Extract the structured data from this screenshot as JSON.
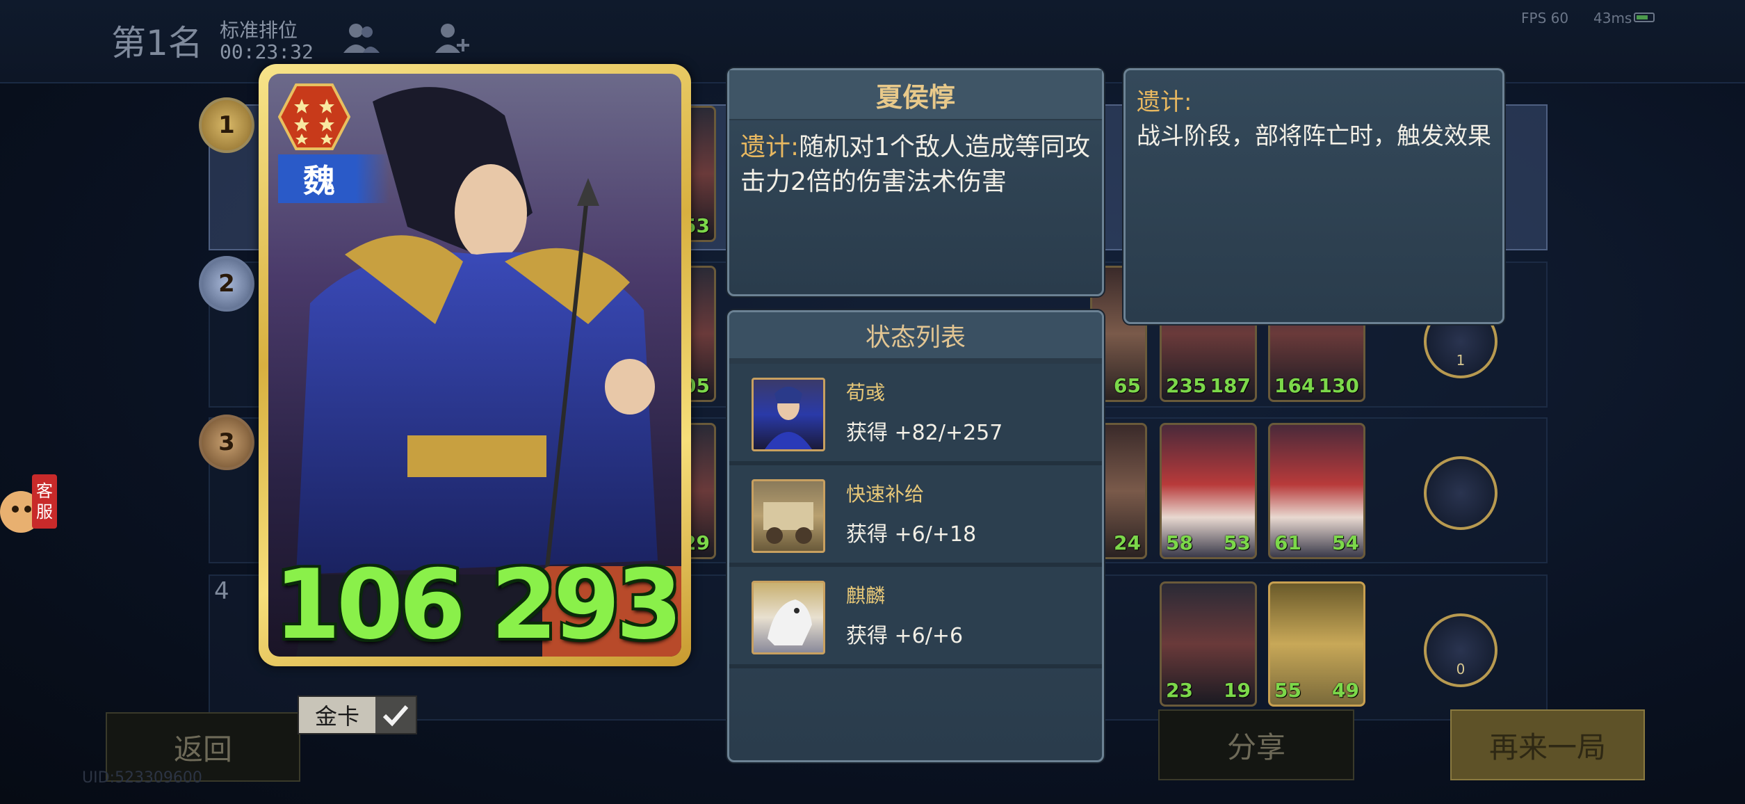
{
  "header": {
    "rank_title": "第1名",
    "mode": "标准排位",
    "elapsed": "00:23:32",
    "fps": "FPS 60",
    "ping": "43ms"
  },
  "rank_rows": [
    {
      "rank": "1"
    },
    {
      "rank": "2"
    },
    {
      "rank": "3"
    },
    {
      "rank": "4"
    }
  ],
  "board_cards": {
    "row2": [
      {
        "atk": "65",
        "hp": ""
      },
      {
        "atk": "235",
        "hp": "187"
      },
      {
        "atk": "164",
        "hp": "130"
      }
    ],
    "row3": [
      {
        "atk": "24",
        "hp": ""
      },
      {
        "atk": "58",
        "hp": "53"
      },
      {
        "atk": "61",
        "hp": "54"
      }
    ],
    "row4": [
      {
        "atk": "23",
        "hp": "19"
      },
      {
        "atk": "55",
        "hp": "49"
      }
    ],
    "left_partial_stats": [
      "53",
      "05",
      "29"
    ],
    "orb_counts": [
      "1",
      "0"
    ]
  },
  "hero": {
    "faction": "魏",
    "attack": "106",
    "health": "293",
    "gold_tag": "金卡"
  },
  "skill_panel": {
    "name": "夏侯惇",
    "skill_key": "遗计:",
    "skill_text": "随机对1个敌人造成等同攻击力2倍的伤害法术伤害"
  },
  "desc_panel": {
    "title": "遗计:",
    "text": "战斗阶段，部将阵亡时，触发效果"
  },
  "status_panel": {
    "title": "状态列表",
    "items": [
      {
        "name": "荀彧",
        "gain": "获得 +82/+257"
      },
      {
        "name": "快速补给",
        "gain": "获得 +6/+18"
      },
      {
        "name": "麒麟",
        "gain": "获得 +6/+6"
      }
    ]
  },
  "buttons": {
    "back": "返回",
    "share": "分享",
    "again": "再来一局"
  },
  "uid": "UID:523309600",
  "cs_badge": "客服"
}
